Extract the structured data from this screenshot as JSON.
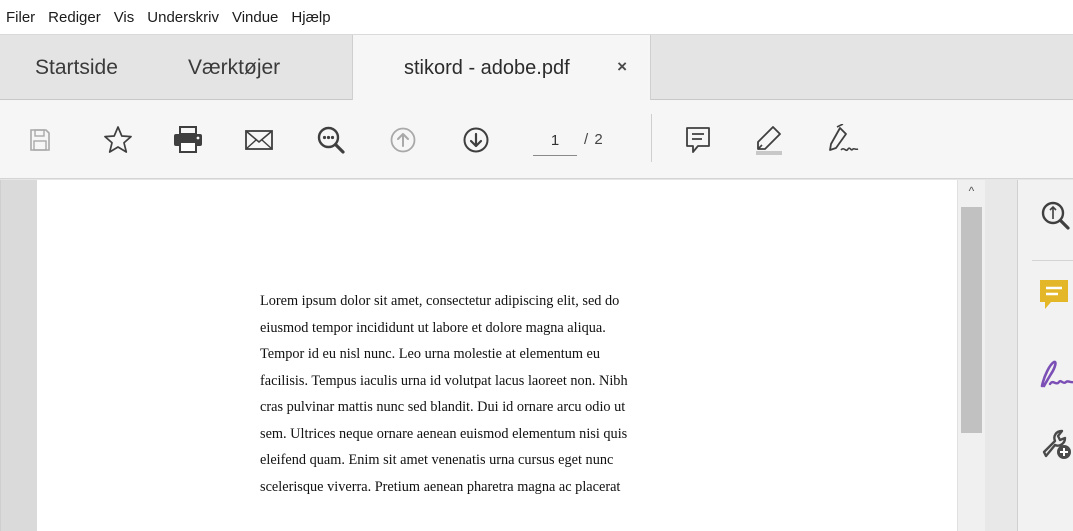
{
  "menu": [
    "Filer",
    "Rediger",
    "Vis",
    "Underskriv",
    "Vindue",
    "Hjælp"
  ],
  "tabs": {
    "startside": "Startside",
    "vaerktojer": "Værktøjer",
    "document": "stikord - adobe.pdf",
    "close_glyph": "×"
  },
  "toolbar": {
    "icons": [
      "save-icon",
      "bookmark-star-icon",
      "print-icon",
      "email-icon",
      "zoom-out-icon",
      "page-up-icon",
      "page-down-icon",
      "comment-icon",
      "highlight-icon",
      "sign-icon"
    ],
    "current_page": "1",
    "total_pages": "/ 2"
  },
  "document": {
    "lines": [
      "Lorem ipsum dolor sit amet, consectetur adipiscing elit, sed do",
      "eiusmod tempor incididunt ut labore et dolore magna aliqua.",
      "Tempor id eu nisl nunc. Leo urna molestie at elementum eu",
      "facilisis. Tempus iaculis urna id volutpat lacus laoreet non. Nibh",
      "cras pulvinar mattis nunc sed blandit. Dui id ornare arcu odio ut",
      "sem. Ultrices neque ornare aenean euismod elementum nisi quis",
      "eleifend quam. Enim sit amet venenatis urna cursus eget nunc",
      "scelerisque viverra. Pretium aenean pharetra magna ac placerat"
    ]
  },
  "right_panel": {
    "icons": [
      "zoom-in-icon",
      "comment-tool-icon",
      "fill-sign-icon",
      "more-tools-icon"
    ],
    "colors": {
      "comment": "#e3b728",
      "sign": "#7b4fb5",
      "tools": "#4a4a4a"
    }
  },
  "scrollbar": {
    "up_glyph": "^"
  }
}
